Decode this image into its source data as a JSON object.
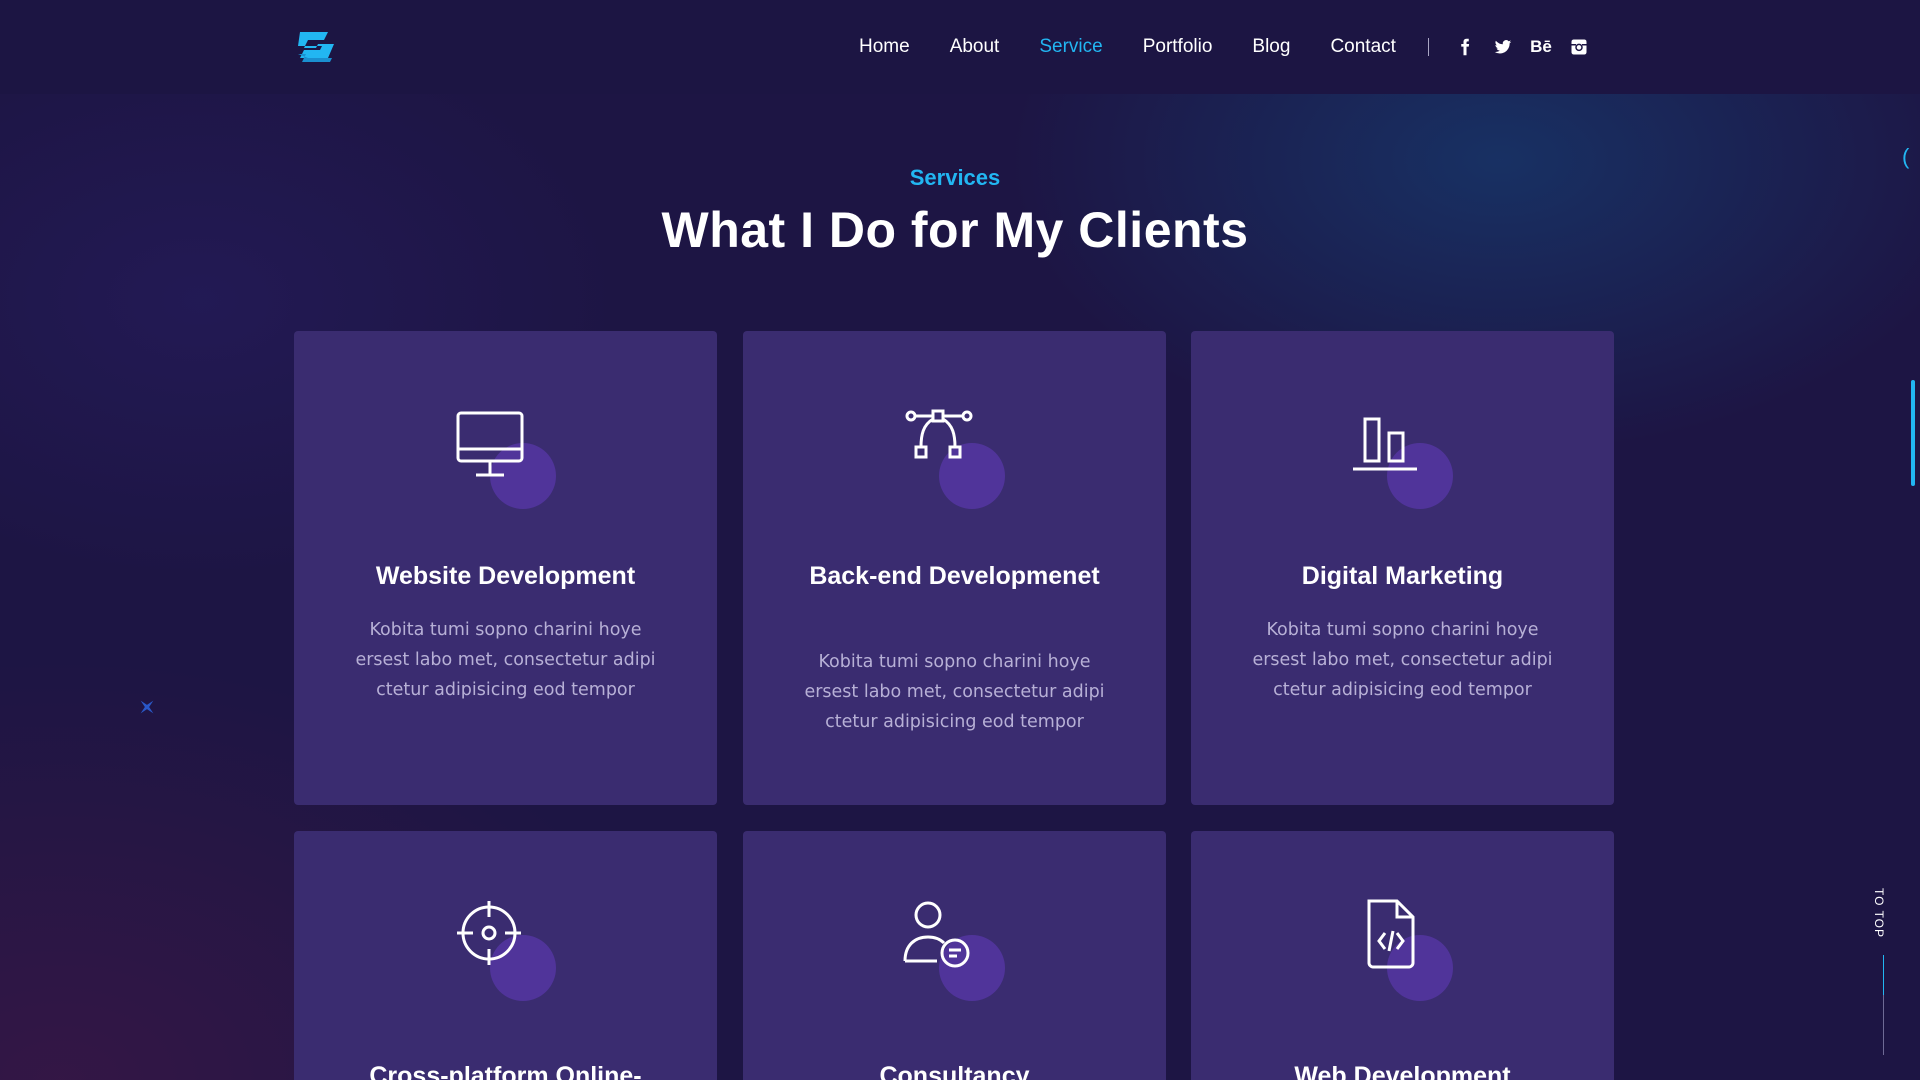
{
  "nav": {
    "items": [
      {
        "label": "Home",
        "active": false
      },
      {
        "label": "About",
        "active": false
      },
      {
        "label": "Service",
        "active": true
      },
      {
        "label": "Portfolio",
        "active": false
      },
      {
        "label": "Blog",
        "active": false
      },
      {
        "label": "Contact",
        "active": false
      }
    ],
    "social": [
      {
        "icon": "facebook-icon"
      },
      {
        "icon": "twitter-icon"
      },
      {
        "icon": "behance-icon",
        "text": "Bē"
      },
      {
        "icon": "instagram-icon"
      }
    ]
  },
  "section": {
    "subtitle": "Services",
    "title": "What I Do for My Clients"
  },
  "cards": [
    {
      "icon": "monitor-icon",
      "title": "Website Development",
      "text": "Kobita tumi sopno charini hoye ersest labo met, consectetur adipi ctetur adipisicing eod tempor"
    },
    {
      "icon": "vector-path-icon",
      "title": "Back-end Developmenet",
      "text": "Kobita tumi sopno charini hoye ersest labo met, consectetur adipi ctetur adipisicing eod tempor"
    },
    {
      "icon": "bar-chart-icon",
      "title": "Digital Marketing",
      "text": "Kobita tumi sopno charini hoye ersest labo met, consectetur adipi ctetur adipisicing eod tempor"
    },
    {
      "icon": "target-icon",
      "title": "Cross-platform Online-",
      "text": ""
    },
    {
      "icon": "user-chat-icon",
      "title": "Consultancy",
      "text": ""
    },
    {
      "icon": "code-file-icon",
      "title": "Web Development",
      "text": ""
    }
  ],
  "to_top": {
    "label": "TO TOP"
  },
  "colors": {
    "accent": "#22b6f2",
    "background": "#1d1544",
    "card": "#3a2c70"
  }
}
